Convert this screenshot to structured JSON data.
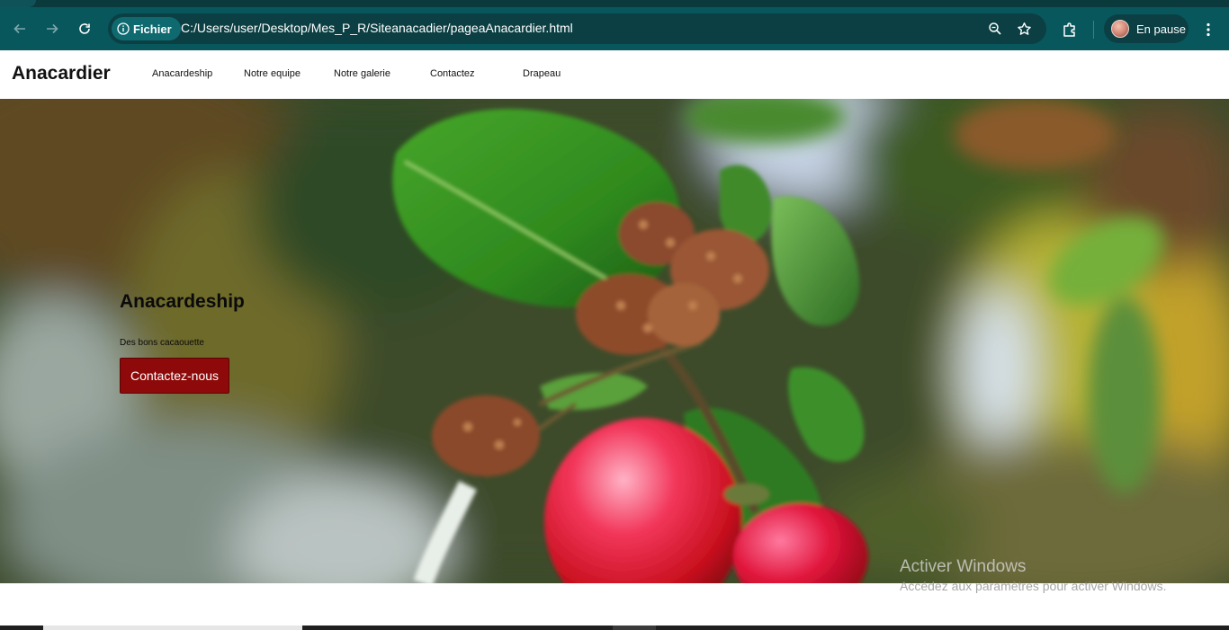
{
  "browser": {
    "back_icon": "arrow-left-icon",
    "forward_icon": "arrow-right-icon",
    "reload_icon": "reload-icon",
    "security_chip_label": "Fichier",
    "url": "C:/Users/user/Desktop/Mes_P_R/Siteanacadier/pageaAnacardier.html",
    "zoom_icon": "zoom-icon",
    "bookmark_icon": "star-icon",
    "extensions_icon": "puzzle-icon",
    "profile_label": "En pause",
    "menu_icon": "kebab-menu-icon",
    "colors": {
      "toolbar": "#08575c",
      "omnibox": "#0b3f43"
    }
  },
  "site": {
    "brand": "Anacardier",
    "nav": [
      {
        "label": "Anacardeship"
      },
      {
        "label": "Notre equipe"
      },
      {
        "label": "Notre galerie"
      },
      {
        "label": "Contactez"
      },
      {
        "label": "Drapeau"
      }
    ]
  },
  "hero": {
    "title": "Anacardeship",
    "subtitle": "Des bons cacaouette",
    "cta_label": "Contactez-nous",
    "cta_color": "#8e0a0a"
  },
  "watermark": {
    "line1": "Activer Windows",
    "line2": "Accédez aux paramètres pour activer Windows."
  }
}
